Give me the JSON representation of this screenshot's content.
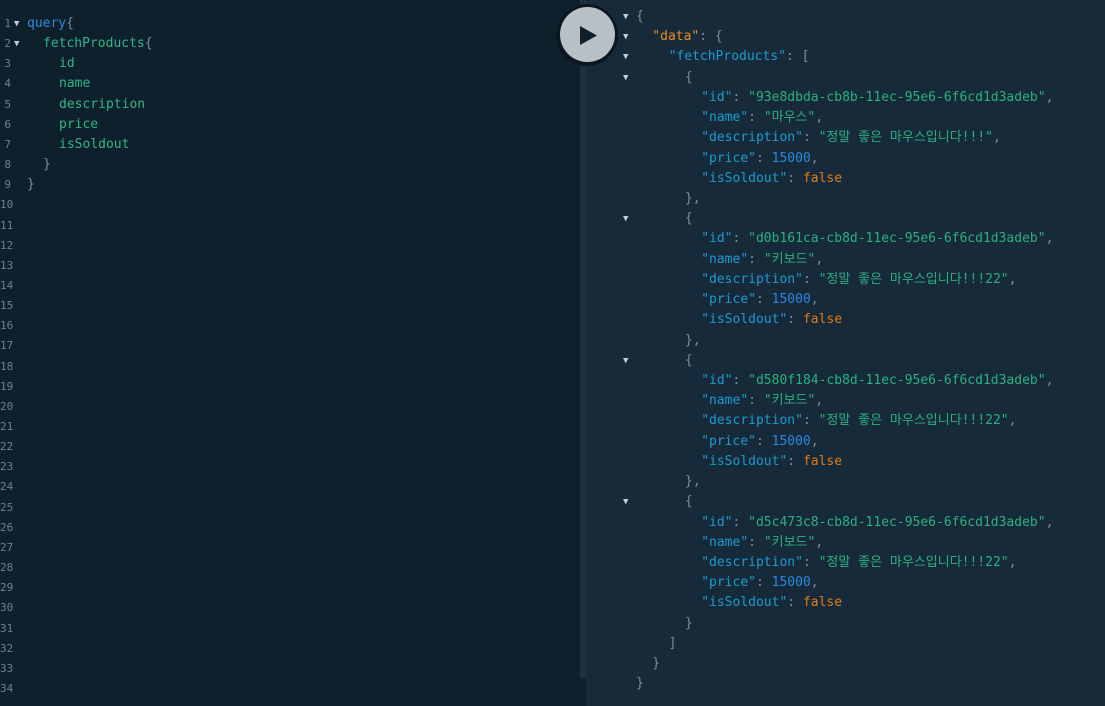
{
  "query_editor": {
    "line_numbers": [
      "1",
      "2",
      "3",
      "4",
      "5",
      "6",
      "7",
      "8",
      "9",
      "10",
      "11",
      "12",
      "13",
      "14",
      "15",
      "16",
      "17",
      "18",
      "19",
      "20",
      "21",
      "22",
      "23",
      "24",
      "25",
      "26",
      "27",
      "28",
      "29",
      "30",
      "31",
      "32",
      "33",
      "34"
    ],
    "lines": [
      {
        "keyword": "query",
        "punct": "{"
      },
      {
        "field": "fetchProducts",
        "punct": "{"
      },
      {
        "field": "id"
      },
      {
        "field": "name"
      },
      {
        "field": "description"
      },
      {
        "field": "price"
      },
      {
        "field": "isSoldout"
      },
      {
        "punct": "}"
      },
      {
        "punct": "}"
      }
    ]
  },
  "run_button": {
    "icon": "play-icon"
  },
  "result": {
    "root_open": "{",
    "data_key": "\"data\"",
    "fetch_key": "\"fetchProducts\"",
    "colon": ": ",
    "obj_open": "{",
    "arr_open": "[",
    "arr_close": "]",
    "obj_close": "}",
    "item_close_comma": "},",
    "comma": ",",
    "keys": {
      "id": "\"id\"",
      "name": "\"name\"",
      "description": "\"description\"",
      "price": "\"price\"",
      "isSoldout": "\"isSoldout\""
    },
    "products": [
      {
        "id": "\"93e8dbda-cb8b-11ec-95e6-6f6cd1d3adeb\"",
        "name": "\"마우스\"",
        "description": "\"정말 좋은 마우스입니다!!!\"",
        "price": "15000",
        "isSoldout": "false"
      },
      {
        "id": "\"d0b161ca-cb8d-11ec-95e6-6f6cd1d3adeb\"",
        "name": "\"키보드\"",
        "description": "\"정말 좋은 마우스입니다!!!22\"",
        "price": "15000",
        "isSoldout": "false"
      },
      {
        "id": "\"d580f184-cb8d-11ec-95e6-6f6cd1d3adeb\"",
        "name": "\"키보드\"",
        "description": "\"정말 좋은 마우스입니다!!!22\"",
        "price": "15000",
        "isSoldout": "false"
      },
      {
        "id": "\"d5c473c8-cb8d-11ec-95e6-6f6cd1d3adeb\"",
        "name": "\"키보드\"",
        "description": "\"정말 좋은 마우스입니다!!!22\"",
        "price": "15000",
        "isSoldout": "false"
      }
    ]
  },
  "colors": {
    "editor_bg": "#0f202d",
    "result_bg": "#172a3a",
    "keyword": "#2f89e0",
    "field": "#30b585",
    "string": "#2cb07e",
    "number": "#2b88e0",
    "boolean": "#e07c17",
    "data_key": "#e98b25"
  }
}
